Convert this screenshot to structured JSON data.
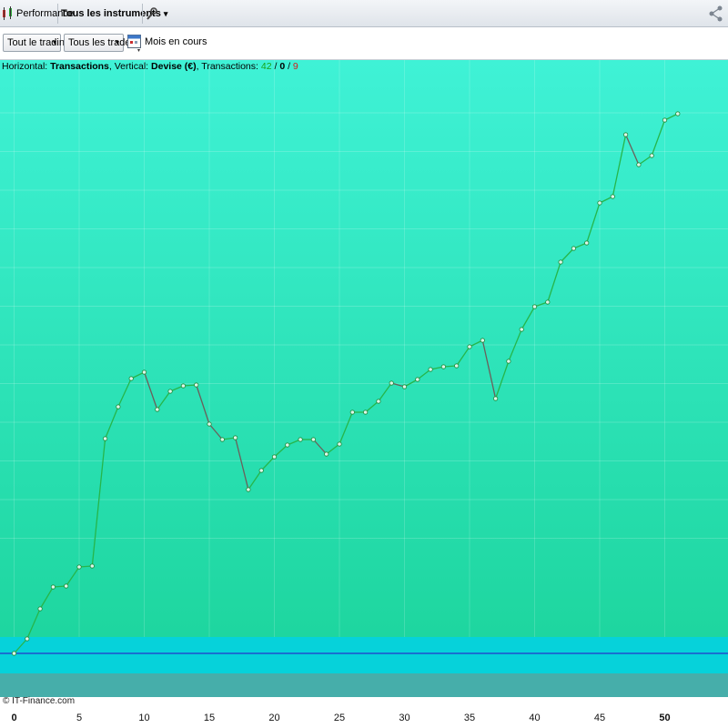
{
  "topbar": {
    "performance_label": "Performance",
    "instruments_label": "Tous les instruments",
    "instruments_arrow": "▾"
  },
  "toolbar": {
    "trading_label": "Tout le trading",
    "trades_label": "Tous les trades",
    "period_label": "Mois en cours",
    "arrow": "▾"
  },
  "summary": {
    "horizontal_label": "Horizontal:",
    "horizontal_value": "Transactions",
    "vertical_label": "Vertical:",
    "vertical_value": "Devise (€)",
    "transactions_label": "Transactions:",
    "count_winning": "42",
    "count_neutral": "0",
    "count_losing": "9",
    "sep": "/"
  },
  "credit": "© IT-Finance.com",
  "colors": {
    "bg_top": "#3ff2d6",
    "bg_bottom": "#1ed69f",
    "band": "#06d2da",
    "zero_line": "#1a6fd0",
    "bottom_band": "#46aeaa",
    "line": "#1f8a3a"
  },
  "chart_data": {
    "type": "line",
    "title": "",
    "xlabel": "",
    "ylabel": "",
    "xlim": [
      -1,
      55
    ],
    "x_ticks": [
      0,
      5,
      10,
      15,
      20,
      25,
      30,
      35,
      40,
      45,
      50
    ],
    "y_ticks_shown": false,
    "grid": true,
    "x": [
      0,
      1,
      2,
      3,
      4,
      5,
      6,
      7,
      8,
      9,
      10,
      11,
      12,
      13,
      14,
      15,
      16,
      17,
      18,
      19,
      20,
      21,
      22,
      23,
      24,
      25,
      26,
      27,
      28,
      29,
      30,
      31,
      32,
      33,
      34,
      35,
      36,
      37,
      38,
      39,
      40,
      41,
      42,
      43,
      44,
      45,
      46,
      47,
      48,
      49,
      50,
      51
    ],
    "series": [
      {
        "values": [
          0,
          16,
          49,
          73,
          74,
          95,
          96,
          236,
          271,
          302,
          309,
          268,
          288,
          294,
          295,
          252,
          235,
          237,
          180,
          201,
          216,
          229,
          235,
          235,
          219,
          230,
          265,
          265,
          277,
          297,
          293,
          301,
          312,
          315,
          316,
          337,
          344,
          280,
          321,
          356,
          381,
          386,
          430,
          445,
          451,
          495,
          502,
          570,
          537,
          547,
          586,
          593
        ],
        "winning": [
          true,
          true,
          true,
          true,
          true,
          true,
          true,
          true,
          true,
          true,
          true,
          false,
          true,
          true,
          true,
          false,
          false,
          true,
          false,
          true,
          true,
          true,
          true,
          true,
          false,
          true,
          true,
          true,
          true,
          true,
          false,
          true,
          true,
          true,
          true,
          true,
          true,
          false,
          true,
          true,
          true,
          true,
          true,
          true,
          true,
          true,
          true,
          true,
          false,
          true,
          true,
          true
        ]
      }
    ]
  }
}
